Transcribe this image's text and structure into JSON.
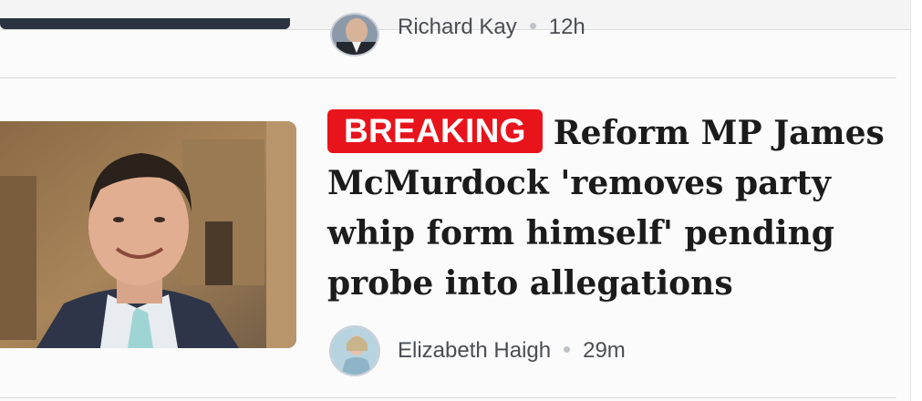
{
  "previous_article": {
    "author": "Richard Kay",
    "time": "12h"
  },
  "article": {
    "badge": "BREAKING",
    "headline": "Reform MP James McMurdock 'removes party whip form himself' pending probe into allegations",
    "author": "Elizabeth Haigh",
    "time": "29m"
  },
  "colors": {
    "badge_bg": "#e8141c",
    "badge_text": "#ffffff",
    "headline_text": "#1b1b1b",
    "meta_text": "#4a4d52"
  },
  "icons": {
    "separator": "dot-separator-icon"
  }
}
